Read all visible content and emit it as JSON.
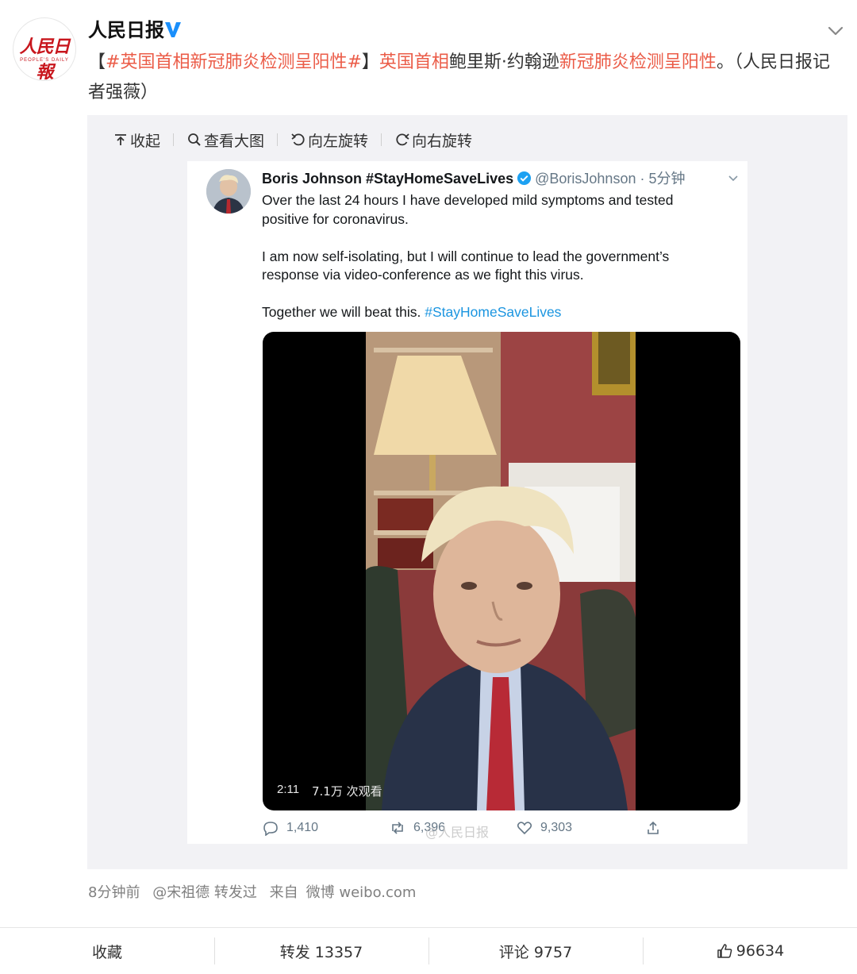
{
  "user": {
    "name": "人民日报",
    "avatar_text": "人民日報",
    "avatar_subtext": "PEOPLE'S DAILY",
    "verified_color": "#1a8ffb"
  },
  "post": {
    "bracket_open": "【",
    "topic": "#英国首相新冠肺炎检测呈阳性#",
    "bracket_close": "】",
    "highlight_1": "英国首相",
    "text_1": "鲍里斯·约翰逊",
    "highlight_2": "新冠肺炎检测呈阳性",
    "text_2": "。（人民日报记者强薇）",
    "highlight_color": "#eb5c48"
  },
  "media_toolbar": {
    "collapse": "收起",
    "view_large": "查看大图",
    "rotate_left": "向左旋转",
    "rotate_right": "向右旋转"
  },
  "tweet": {
    "name": "Boris Johnson #StayHomeSaveLives",
    "handle": "@BorisJohnson",
    "time": "· 5分钟",
    "para1": "Over the last 24 hours I have developed mild symptoms and tested positive for coronavirus.",
    "para2": "I am now self-isolating, but I will continue to lead the government’s response via video-conference as we fight this virus.",
    "para3_text": "Together we will beat this.",
    "para3_tag": "#StayHomeSaveLives",
    "video_duration": "2:11",
    "video_views": "7.1万 次观看",
    "replies": "1,410",
    "retweets": "6,396",
    "likes": "9,303",
    "watermark": "@人民日报"
  },
  "meta": {
    "time": "8分钟前",
    "forwarded_by": "@宋祖德 转发过",
    "source_label": "来自",
    "source": "微博 weibo.com"
  },
  "actions": {
    "favorite": "收藏",
    "repost": "转发 13357",
    "comment": "评论 9757",
    "like": "96634"
  }
}
